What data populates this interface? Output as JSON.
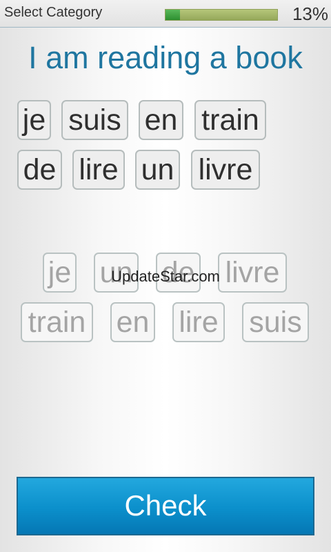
{
  "header": {
    "category_label": "Select Category",
    "progress_percent_label": "13%",
    "progress_fraction": 0.13
  },
  "prompt": "I am reading a book",
  "answer_words": [
    "je",
    "suis",
    "en",
    "train",
    "de",
    "lire",
    "un",
    "livre"
  ],
  "pool_words": [
    "je",
    "un",
    "de",
    "livre",
    "train",
    "en",
    "lire",
    "suis"
  ],
  "watermark": "UpdateStar.com",
  "check_button_label": "Check",
  "colors": {
    "prompt": "#1f76a0",
    "button": "#0b8fcb",
    "progress_fill": "#3aa63d",
    "progress_track": "#a9bb6b"
  }
}
